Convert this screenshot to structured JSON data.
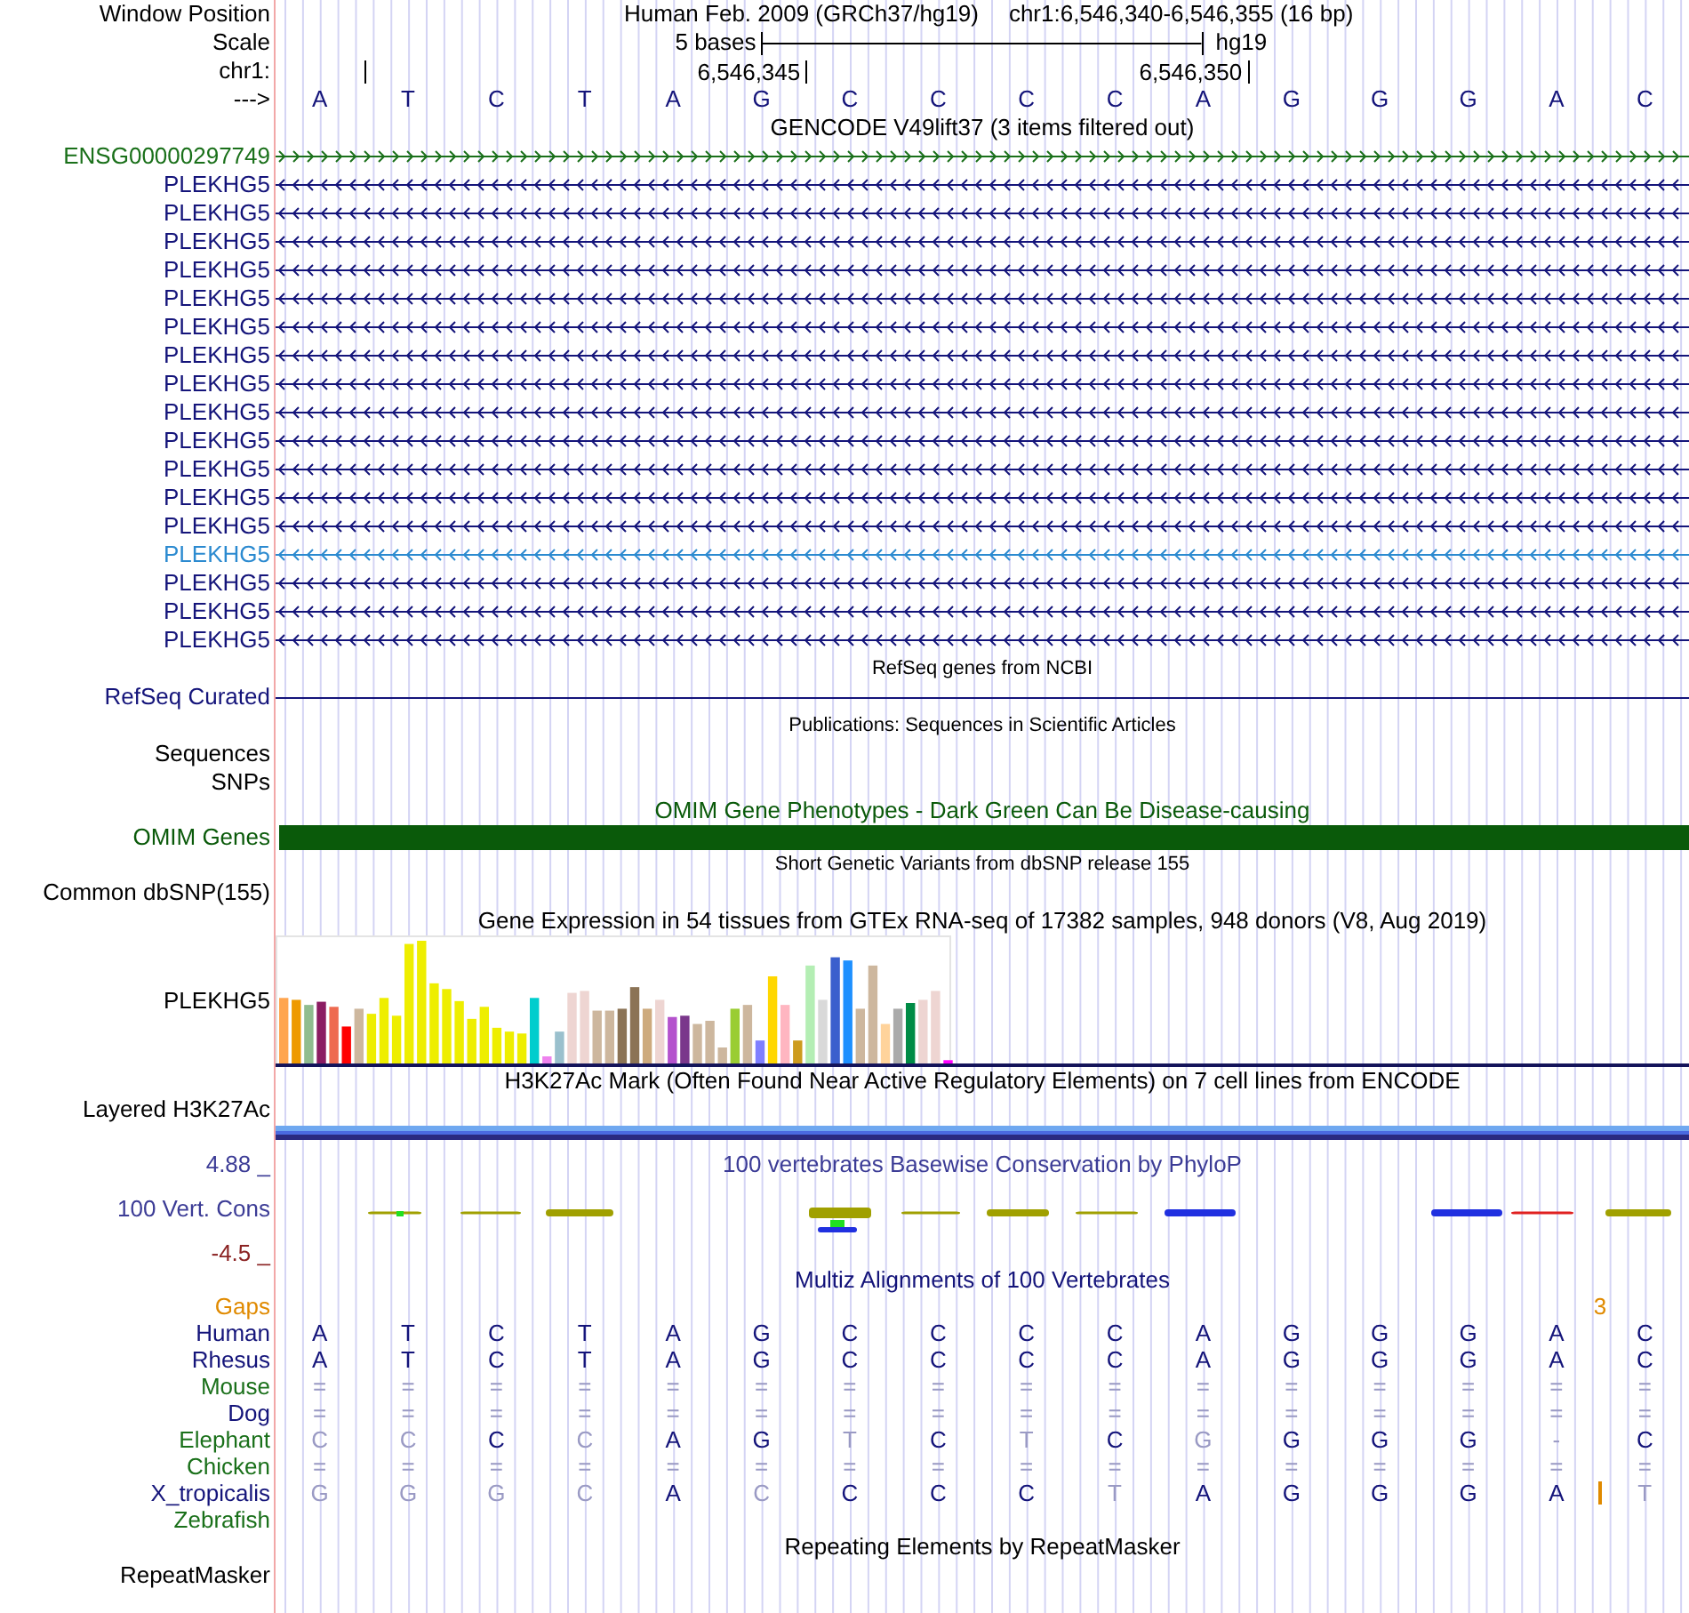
{
  "ruler": {
    "window_label": "Window Position",
    "assembly_text": "Human Feb. 2009 (GRCh37/hg19)",
    "position_text": "chr1:6,546,340-6,546,355 (16 bp)",
    "scale_label": "Scale",
    "scale_text": "5 bases",
    "assembly": "hg19",
    "chrom_label": "chr1:",
    "ticks": [
      "6,546,345",
      "6,546,350"
    ],
    "strand_label": "--->",
    "bases": [
      "A",
      "T",
      "C",
      "T",
      "A",
      "G",
      "C",
      "C",
      "C",
      "C",
      "A",
      "G",
      "G",
      "G",
      "A",
      "C"
    ]
  },
  "tracks": [
    {
      "kind": "genes",
      "title": {
        "text": "GENCODE V49lift37 (3 items filtered out)",
        "color": "#000000"
      },
      "items": [
        {
          "label": "ENSG00000297749",
          "reverse": false,
          "color": "#1a701a"
        },
        {
          "label": "PLEKHG5",
          "reverse": true,
          "color": "#14147a"
        },
        {
          "label": "PLEKHG5",
          "reverse": true,
          "color": "#14147a"
        },
        {
          "label": "PLEKHG5",
          "reverse": true,
          "color": "#14147a"
        },
        {
          "label": "PLEKHG5",
          "reverse": true,
          "color": "#14147a"
        },
        {
          "label": "PLEKHG5",
          "reverse": true,
          "color": "#14147a"
        },
        {
          "label": "PLEKHG5",
          "reverse": true,
          "color": "#14147a"
        },
        {
          "label": "PLEKHG5",
          "reverse": true,
          "color": "#14147a"
        },
        {
          "label": "PLEKHG5",
          "reverse": true,
          "color": "#14147a"
        },
        {
          "label": "PLEKHG5",
          "reverse": true,
          "color": "#14147a"
        },
        {
          "label": "PLEKHG5",
          "reverse": true,
          "color": "#14147a"
        },
        {
          "label": "PLEKHG5",
          "reverse": true,
          "color": "#14147a"
        },
        {
          "label": "PLEKHG5",
          "reverse": true,
          "color": "#14147a"
        },
        {
          "label": "PLEKHG5",
          "reverse": true,
          "color": "#14147a"
        },
        {
          "label": "PLEKHG5",
          "reverse": true,
          "color": "#2b8ad0"
        },
        {
          "label": "PLEKHG5",
          "reverse": true,
          "color": "#14147a"
        },
        {
          "label": "PLEKHG5",
          "reverse": true,
          "color": "#14147a"
        },
        {
          "label": "PLEKHG5",
          "reverse": true,
          "color": "#14147a"
        }
      ]
    },
    {
      "kind": "line",
      "title": {
        "text": "RefSeq genes from NCBI",
        "color": "#000000"
      },
      "labels": [
        {
          "text": "RefSeq Curated",
          "color": "#14147a"
        }
      ]
    },
    {
      "kind": "collapsed",
      "title": {
        "text": "Publications: Sequences in Scientific Articles",
        "color": "#000000"
      },
      "labels": [
        {
          "text": "Sequences",
          "color": "#000000"
        },
        {
          "text": "SNPs",
          "color": "#000000"
        }
      ]
    },
    {
      "kind": "bar",
      "title": {
        "text": "OMIM Gene Phenotypes - Dark Green Can Be Disease-causing",
        "color": "#0a5a0a"
      },
      "labels": [
        {
          "text": "OMIM Genes",
          "color": "#0a5a0a"
        }
      ]
    },
    {
      "kind": "collapsed",
      "title": {
        "text": "Short Genetic Variants from dbSNP release 155",
        "color": "#000000"
      },
      "labels": [
        {
          "text": "Common dbSNP(155)",
          "color": "#000000"
        }
      ]
    },
    {
      "kind": "expression",
      "title": {
        "text": "Gene Expression in 54 tissues from GTEx RNA-seq of 17382 samples, 948 donors (V8, Aug 2019)",
        "color": "#000000"
      },
      "labels": [
        {
          "text": "PLEKHG5",
          "color": "#000000"
        }
      ]
    },
    {
      "kind": "signal",
      "title": {
        "text": "H3K27Ac Mark (Often Found Near Active Regulatory Elements) on 7 cell lines from ENCODE",
        "color": "#000000"
      },
      "labels": [
        {
          "text": "Layered H3K27Ac",
          "color": "#000000"
        }
      ]
    },
    {
      "kind": "conservation",
      "title": {
        "text": "100 vertebrates Basewise Conservation by PhyloP",
        "color": "#3c3c96"
      },
      "labels": [
        {
          "text": "100 Vert. Cons",
          "color": "#3c3c96"
        }
      ],
      "ymax": {
        "text": "4.88 _",
        "color": "#3c3c96"
      },
      "ymin": {
        "text": "-4.5 _",
        "color": "#8b2323"
      }
    },
    {
      "kind": "multiz",
      "title": {
        "text": "Multiz Alignments of 100 Vertebrates",
        "color": "#14147a"
      },
      "gaps": {
        "label": "Gaps",
        "text": "3",
        "color": "#e08a00"
      },
      "species": [
        {
          "name": "Human",
          "color": "#14147a",
          "cells": [
            {
              "base": "A",
              "faded": false
            },
            {
              "base": "T",
              "faded": false
            },
            {
              "base": "C",
              "faded": false
            },
            {
              "base": "T",
              "faded": false
            },
            {
              "base": "A",
              "faded": false
            },
            {
              "base": "G",
              "faded": false
            },
            {
              "base": "C",
              "faded": false
            },
            {
              "base": "C",
              "faded": false
            },
            {
              "base": "C",
              "faded": false
            },
            {
              "base": "C",
              "faded": false
            },
            {
              "base": "A",
              "faded": false
            },
            {
              "base": "G",
              "faded": false
            },
            {
              "base": "G",
              "faded": false
            },
            {
              "base": "G",
              "faded": false
            },
            {
              "base": "A",
              "faded": false
            },
            {
              "base": "C",
              "faded": false
            }
          ]
        },
        {
          "name": "Rhesus",
          "color": "#14147a",
          "cells": [
            {
              "base": "A",
              "faded": false
            },
            {
              "base": "T",
              "faded": false
            },
            {
              "base": "C",
              "faded": false
            },
            {
              "base": "T",
              "faded": false
            },
            {
              "base": "A",
              "faded": false
            },
            {
              "base": "G",
              "faded": false
            },
            {
              "base": "C",
              "faded": false
            },
            {
              "base": "C",
              "faded": false
            },
            {
              "base": "C",
              "faded": false
            },
            {
              "base": "C",
              "faded": false
            },
            {
              "base": "A",
              "faded": false
            },
            {
              "base": "G",
              "faded": false
            },
            {
              "base": "G",
              "faded": false
            },
            {
              "base": "G",
              "faded": false
            },
            {
              "base": "A",
              "faded": false
            },
            {
              "base": "C",
              "faded": false
            }
          ]
        },
        {
          "name": "Mouse",
          "color": "#1a701a",
          "cells": [
            {
              "base": "=",
              "faded": true
            },
            {
              "base": "=",
              "faded": true
            },
            {
              "base": "=",
              "faded": true
            },
            {
              "base": "=",
              "faded": true
            },
            {
              "base": "=",
              "faded": true
            },
            {
              "base": "=",
              "faded": true
            },
            {
              "base": "=",
              "faded": true
            },
            {
              "base": "=",
              "faded": true
            },
            {
              "base": "=",
              "faded": true
            },
            {
              "base": "=",
              "faded": true
            },
            {
              "base": "=",
              "faded": true
            },
            {
              "base": "=",
              "faded": true
            },
            {
              "base": "=",
              "faded": true
            },
            {
              "base": "=",
              "faded": true
            },
            {
              "base": "=",
              "faded": true
            },
            {
              "base": "=",
              "faded": true
            }
          ]
        },
        {
          "name": "Dog",
          "color": "#14147a",
          "cells": [
            {
              "base": "=",
              "faded": true
            },
            {
              "base": "=",
              "faded": true
            },
            {
              "base": "=",
              "faded": true
            },
            {
              "base": "=",
              "faded": true
            },
            {
              "base": "=",
              "faded": true
            },
            {
              "base": "=",
              "faded": true
            },
            {
              "base": "=",
              "faded": true
            },
            {
              "base": "=",
              "faded": true
            },
            {
              "base": "=",
              "faded": true
            },
            {
              "base": "=",
              "faded": true
            },
            {
              "base": "=",
              "faded": true
            },
            {
              "base": "=",
              "faded": true
            },
            {
              "base": "=",
              "faded": true
            },
            {
              "base": "=",
              "faded": true
            },
            {
              "base": "=",
              "faded": true
            },
            {
              "base": "=",
              "faded": true
            }
          ]
        },
        {
          "name": "Elephant",
          "color": "#1a701a",
          "cells": [
            {
              "base": "C",
              "faded": true
            },
            {
              "base": "C",
              "faded": true
            },
            {
              "base": "C",
              "faded": false
            },
            {
              "base": "C",
              "faded": true
            },
            {
              "base": "A",
              "faded": false
            },
            {
              "base": "G",
              "faded": false
            },
            {
              "base": "T",
              "faded": true
            },
            {
              "base": "C",
              "faded": false
            },
            {
              "base": "T",
              "faded": true
            },
            {
              "base": "C",
              "faded": false
            },
            {
              "base": "G",
              "faded": true
            },
            {
              "base": "G",
              "faded": false
            },
            {
              "base": "G",
              "faded": false
            },
            {
              "base": "G",
              "faded": false
            },
            {
              "base": "-",
              "faded": true
            },
            {
              "base": "C",
              "faded": false
            }
          ]
        },
        {
          "name": "Chicken",
          "color": "#1a701a",
          "cells": [
            {
              "base": "=",
              "faded": true
            },
            {
              "base": "=",
              "faded": true
            },
            {
              "base": "=",
              "faded": true
            },
            {
              "base": "=",
              "faded": true
            },
            {
              "base": "=",
              "faded": true
            },
            {
              "base": "=",
              "faded": true
            },
            {
              "base": "=",
              "faded": true
            },
            {
              "base": "=",
              "faded": true
            },
            {
              "base": "=",
              "faded": true
            },
            {
              "base": "=",
              "faded": true
            },
            {
              "base": "=",
              "faded": true
            },
            {
              "base": "=",
              "faded": true
            },
            {
              "base": "=",
              "faded": true
            },
            {
              "base": "=",
              "faded": true
            },
            {
              "base": "=",
              "faded": true
            },
            {
              "base": "=",
              "faded": true
            }
          ]
        },
        {
          "name": "X_tropicalis",
          "color": "#14147a",
          "cells": [
            {
              "base": "G",
              "faded": true
            },
            {
              "base": "G",
              "faded": true
            },
            {
              "base": "G",
              "faded": true
            },
            {
              "base": "C",
              "faded": true
            },
            {
              "base": "A",
              "faded": false
            },
            {
              "base": "C",
              "faded": true
            },
            {
              "base": "C",
              "faded": false
            },
            {
              "base": "C",
              "faded": false
            },
            {
              "base": "C",
              "faded": false
            },
            {
              "base": "T",
              "faded": true
            },
            {
              "base": "A",
              "faded": false
            },
            {
              "base": "G",
              "faded": false
            },
            {
              "base": "G",
              "faded": false
            },
            {
              "base": "G",
              "faded": false
            },
            {
              "base": "A",
              "faded": false
            },
            {
              "base": "T",
              "faded": true,
              "insert_before": true
            }
          ]
        },
        {
          "name": "Zebrafish",
          "color": "#1a701a"
        }
      ]
    },
    {
      "kind": "annotation",
      "title": {
        "text": "Repeating Elements by RepeatMasker",
        "color": "#000000"
      },
      "labels": [
        {
          "text": "RepeatMasker",
          "color": "#000000"
        }
      ]
    }
  ]
}
